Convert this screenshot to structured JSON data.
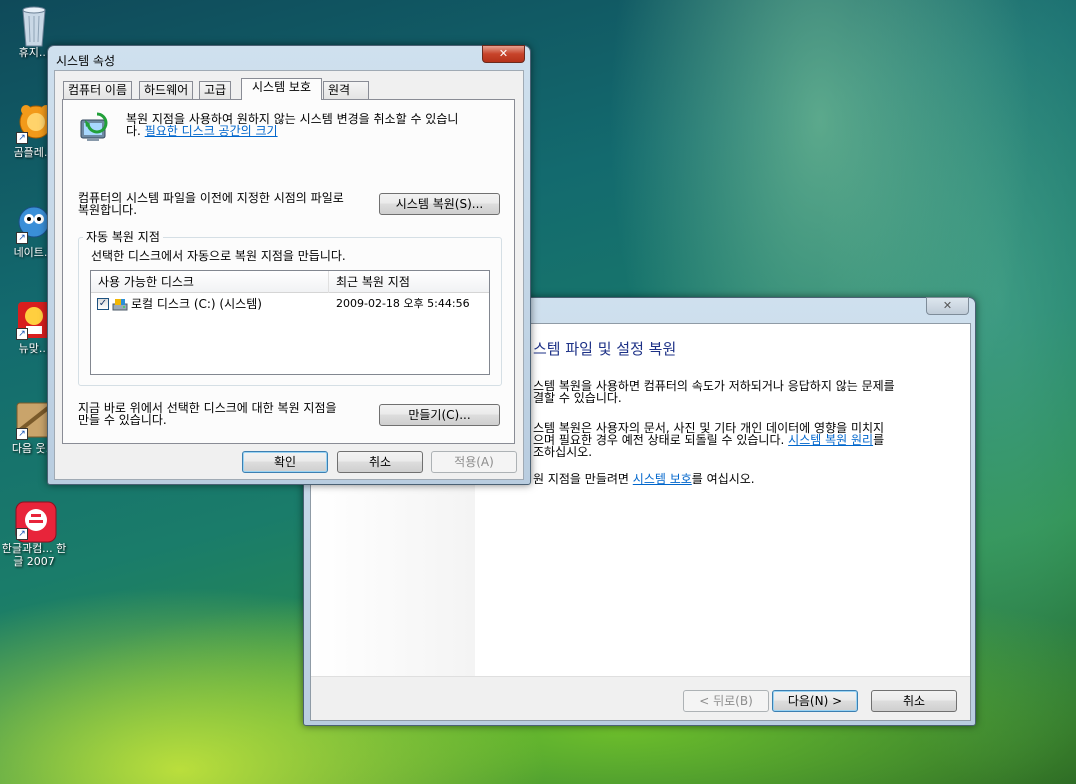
{
  "desktop": {
    "icons": [
      {
        "label": "휴지..."
      },
      {
        "label": "곰플레..."
      },
      {
        "label": "네이트..."
      },
      {
        "label": "뉴맞..."
      },
      {
        "label": "다음 웃..."
      },
      {
        "label": "한글과컴... 한글 2007"
      }
    ]
  },
  "system_properties": {
    "title": "시스템 속성",
    "close_glyph": "✕",
    "tabs": [
      "컴퓨터 이름",
      "하드웨어",
      "고급",
      "시스템 보호",
      "원격"
    ],
    "intro_text_line1": "복원 지점을 사용하여 원하지 않는 시스템 변경을 취소할 수 있습니",
    "intro_text_line2": "다.",
    "intro_link": "필요한 디스크 공간의 크기",
    "restore_text_line1": "컴퓨터의 시스템 파일을 이전에 지정한 시점의 파일로",
    "restore_text_line2": "복원합니다.",
    "restore_button": "시스템 복원(S)...",
    "group_title": "자동 복원 지점",
    "group_desc": "선택한 디스크에서 자동으로 복원 지점을 만듭니다.",
    "list_headers": [
      "사용 가능한 디스크",
      "최근 복원 지점"
    ],
    "list_rows": [
      {
        "checked": "✓",
        "disk": "로컬 디스크 (C:) (시스템)",
        "last_point": "2009-02-18 오후 5:44:56"
      }
    ],
    "create_text_line1": "지금 바로 위에서 선택한 디스크에 대한 복원 지점을",
    "create_text_line2": "만들 수 있습니다.",
    "create_button": "만들기(C)...",
    "ok_button": "확인",
    "cancel_button": "취소",
    "apply_button": "적용(A)"
  },
  "restore_wizard": {
    "close_glyph": "✕",
    "heading": "스템 파일 및 설정 복원",
    "para1_line1": "스템 복원을 사용하면 컴퓨터의 속도가 저하되거나 응답하지 않는 문제를",
    "para1_line2": "결할 수 있습니다.",
    "para2_line1": "스템 복원은 사용자의 문서, 사진 및 기타 개인 데이터에 영향을 미치지",
    "para2_line2_prefix": "으며 필요한 경우 예전 상태로 되돌릴 수 있습니다.",
    "para2_link": "시스템 복원 원리",
    "para2_line2_suffix": "를",
    "para2_line3": "조하십시오.",
    "para3_prefix": "원 지점을 만들려면",
    "para3_link": "시스템 보호",
    "para3_suffix": "를 여십시오.",
    "back_button": "< 뒤로(B)",
    "next_button": "다음(N) >",
    "cancel_button": "취소"
  },
  "colors": {
    "link": "#0066cc",
    "close_button": "#c7432a",
    "window_frame": "#cfe0ee"
  }
}
